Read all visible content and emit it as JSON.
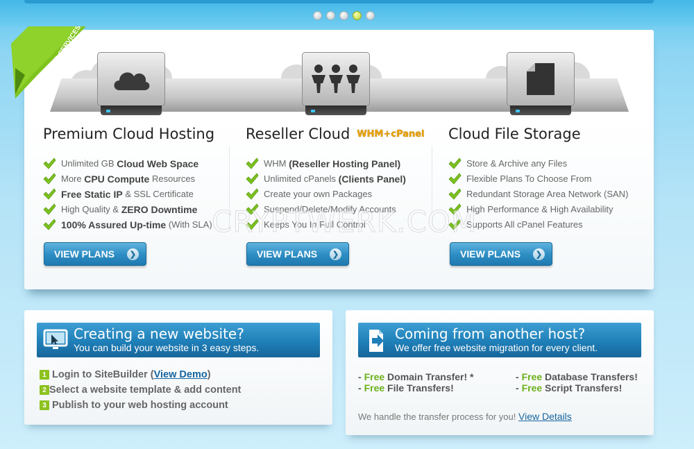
{
  "slider": {
    "dots": [
      1,
      2,
      3,
      4,
      5
    ],
    "active_index": 3
  },
  "ribbon": {
    "label": "FEATURED SERVICES"
  },
  "services": [
    {
      "title": "Premium Cloud Hosting",
      "icon": "cloud-icon",
      "features": [
        {
          "parts": [
            {
              "t": "Unlimited GB ",
              "b": false
            },
            {
              "t": "Cloud Web Space",
              "b": true
            }
          ]
        },
        {
          "parts": [
            {
              "t": "More ",
              "b": false
            },
            {
              "t": "CPU Compute",
              "b": true
            },
            {
              "t": " Resources",
              "b": false
            }
          ]
        },
        {
          "parts": [
            {
              "t": "Free Static IP",
              "b": true
            },
            {
              "t": " & SSL Certificate",
              "b": false
            }
          ]
        },
        {
          "parts": [
            {
              "t": "High Quality & ",
              "b": false
            },
            {
              "t": "ZERO Downtime",
              "b": true
            }
          ]
        },
        {
          "parts": [
            {
              "t": "100% Assured Up-time",
              "b": true
            },
            {
              "t": " (With SLA)",
              "b": false
            }
          ]
        }
      ],
      "button": "VIEW PLANS"
    },
    {
      "title": "Reseller Cloud",
      "icon": "people-icon",
      "badge": "WHM+cPanel",
      "features": [
        {
          "parts": [
            {
              "t": "WHM ",
              "b": false
            },
            {
              "t": "(Reseller Hosting Panel)",
              "b": true
            }
          ]
        },
        {
          "parts": [
            {
              "t": "Unlimited cPanels ",
              "b": false
            },
            {
              "t": "(Clients Panel)",
              "b": true
            }
          ]
        },
        {
          "parts": [
            {
              "t": "Create your own Packages",
              "b": false
            }
          ]
        },
        {
          "parts": [
            {
              "t": "Suspend/Delete/Modify Accounts",
              "b": false
            }
          ]
        },
        {
          "parts": [
            {
              "t": "Keeps You In Full Control",
              "b": false
            }
          ]
        }
      ],
      "button": "VIEW PLANS"
    },
    {
      "title": "Cloud File Storage",
      "icon": "file-icon",
      "features": [
        {
          "parts": [
            {
              "t": "Store & Archive any Files",
              "b": false
            }
          ]
        },
        {
          "parts": [
            {
              "t": "Flexible Plans To Choose From",
              "b": false
            }
          ]
        },
        {
          "parts": [
            {
              "t": "Redundant Storage Area Network (SAN)",
              "b": false
            }
          ]
        },
        {
          "parts": [
            {
              "t": "High Performance & High Availability",
              "b": false
            }
          ]
        },
        {
          "parts": [
            {
              "t": "Supports All cPanel Features",
              "b": false
            }
          ]
        }
      ],
      "button": "VIEW PLANS"
    }
  ],
  "watermark": "CRYPTWERK.COM",
  "website_box": {
    "title": "Creating a new website?",
    "subtitle": "You can build your website in 3 easy steps.",
    "steps": [
      {
        "num": "1",
        "pre": "Login to SiteBuilder (",
        "link": "View Demo",
        "post": ")"
      },
      {
        "num": "2",
        "pre": "Select a website template & add content",
        "link": "",
        "post": ""
      },
      {
        "num": "3",
        "pre": "Publish to your web hosting account",
        "link": "",
        "post": ""
      }
    ]
  },
  "host_box": {
    "title": "Coming from another host?",
    "subtitle": "We offer free website migration for every client.",
    "col1": [
      {
        "dash": "- ",
        "free": "Free",
        "rest": " Domain Transfer! *"
      },
      {
        "dash": "- ",
        "free": "Free",
        "rest": " File Transfers!"
      }
    ],
    "col2": [
      {
        "dash": "- ",
        "free": "Free",
        "rest": " Database Transfers!"
      },
      {
        "dash": "- ",
        "free": "Free",
        "rest": " Script Transfers!"
      }
    ],
    "note": "We handle the transfer process for you!",
    "note_link": "View Details"
  },
  "colors": {
    "accent_blue": "#1f7fb8",
    "green": "#6bb11a"
  }
}
